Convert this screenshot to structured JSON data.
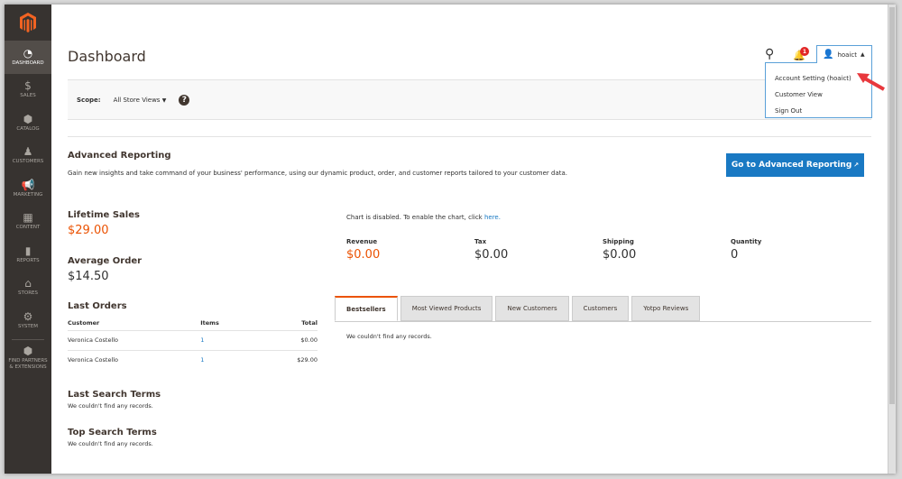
{
  "sidebar": {
    "items": [
      {
        "label": "DASHBOARD",
        "icon": "dashboard-icon",
        "glyph": "◔"
      },
      {
        "label": "SALES",
        "icon": "dollar-icon",
        "glyph": "$"
      },
      {
        "label": "CATALOG",
        "icon": "box-icon",
        "glyph": "⬢"
      },
      {
        "label": "CUSTOMERS",
        "icon": "person-icon",
        "glyph": "♟"
      },
      {
        "label": "MARKETING",
        "icon": "megaphone-icon",
        "glyph": "📢"
      },
      {
        "label": "CONTENT",
        "icon": "layout-icon",
        "glyph": "▦"
      },
      {
        "label": "REPORTS",
        "icon": "bar-chart-icon",
        "glyph": "▮"
      },
      {
        "label": "STORES",
        "icon": "storefront-icon",
        "glyph": "⌂"
      },
      {
        "label": "SYSTEM",
        "icon": "gear-icon",
        "glyph": "⚙"
      }
    ],
    "partners": "FIND PARTNERS & EXTENSIONS"
  },
  "header": {
    "title": "Dashboard",
    "notification_count": "1",
    "user": "hoaict",
    "menu": [
      "Account Setting (hoaict)",
      "Customer View",
      "Sign Out"
    ]
  },
  "scope": {
    "label": "Scope:",
    "value": "All Store Views",
    "help": "?"
  },
  "advanced": {
    "title": "Advanced Reporting",
    "text": "Gain new insights and take command of your business' performance, using our dynamic product, order, and customer reports tailored to your customer data.",
    "button": "Go to Advanced Reporting"
  },
  "lifetime": {
    "label": "Lifetime Sales",
    "value": "$29.00"
  },
  "average": {
    "label": "Average Order",
    "value": "$14.50"
  },
  "orders": {
    "title": "Last Orders",
    "headers": [
      "Customer",
      "Items",
      "Total"
    ],
    "rows": [
      [
        "Veronica Costello",
        "1",
        "$0.00"
      ],
      [
        "Veronica Costello",
        "1",
        "$29.00"
      ]
    ]
  },
  "search": {
    "last_title": "Last Search Terms",
    "last_empty": "We couldn't find any records.",
    "top_title": "Top Search Terms",
    "top_empty": "We couldn't find any records."
  },
  "chart": {
    "text": "Chart is disabled. To enable the chart, click ",
    "link": "here."
  },
  "totals": [
    {
      "label": "Revenue",
      "value": "$0.00"
    },
    {
      "label": "Tax",
      "value": "$0.00"
    },
    {
      "label": "Shipping",
      "value": "$0.00"
    },
    {
      "label": "Quantity",
      "value": "0"
    }
  ],
  "tabs": [
    "Bestsellers",
    "Most Viewed Products",
    "New Customers",
    "Customers",
    "Yotpo Reviews"
  ],
  "tab_empty": "We couldn't find any records.",
  "colors": {
    "accent": "#eb5202",
    "button": "#1979c3",
    "sidebar": "#373330"
  }
}
